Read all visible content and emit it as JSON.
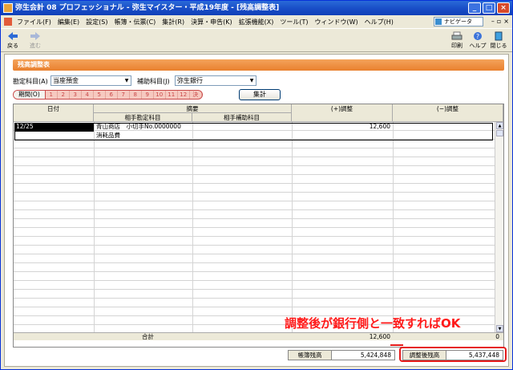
{
  "window": {
    "title": "弥生会計 08 プロフェッショナル - 弥生マイスター・平成19年度 - [残高調整表]"
  },
  "menu": [
    "ファイル(F)",
    "編集(E)",
    "設定(S)",
    "帳簿・伝票(C)",
    "集計(R)",
    "決算・申告(K)",
    "拡張機能(X)",
    "ツール(T)",
    "ウィンドウ(W)",
    "ヘルプ(H)"
  ],
  "navi_label": "ナビゲータ",
  "toolbar": {
    "back": "戻る",
    "forward": "進む",
    "print": "印刷",
    "help": "ヘルプ",
    "close": "閉じる"
  },
  "section_title": "残高調整表",
  "filters": {
    "account_label": "勘定科目(A)",
    "account_value": "当座預金",
    "sub_label": "補助科目(J)",
    "sub_value": "弥生銀行"
  },
  "period": {
    "label": "期間(O)",
    "months": [
      "1",
      "2",
      "3",
      "4",
      "5",
      "6",
      "7",
      "8",
      "9",
      "10",
      "11",
      "12",
      "決"
    ]
  },
  "aggregate_button": "集計",
  "table": {
    "headers": {
      "date": "日付",
      "summary": "摘要",
      "counter_account": "相手勘定科目",
      "counter_sub": "相手補助科目",
      "plus": "(+)調整",
      "minus": "(−)調整"
    },
    "row1": {
      "date": "12/25",
      "summary": "青山商店　小切手No.0000000",
      "plus": "12,600",
      "account": "消耗品費"
    },
    "total_label": "合計",
    "total_plus": "12,600",
    "total_minus": "0"
  },
  "footer": {
    "book_label": "帳簿残高",
    "book_value": "5,424,848",
    "adjusted_label": "調整後残高",
    "adjusted_value": "5,437,448"
  },
  "annotation": "調整後が銀行側と一致すればOK"
}
